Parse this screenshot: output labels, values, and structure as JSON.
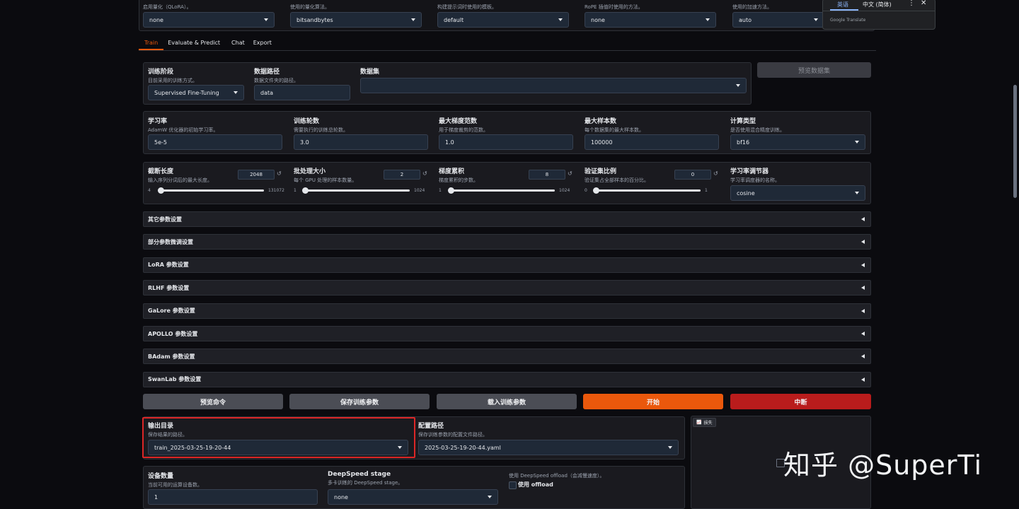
{
  "top_row": [
    {
      "label": "启用量化（QLoRA）。",
      "value": "none"
    },
    {
      "label": "使用的量化算法。",
      "value": "bitsandbytes"
    },
    {
      "label": "构建提示词时使用的模板。",
      "value": "default"
    },
    {
      "label": "RoPE 插值时使用的方法。",
      "value": "none"
    },
    {
      "label": "使用的加速方法。",
      "value": "auto"
    }
  ],
  "translate_popup": {
    "tab_active": "英语",
    "tab_other": "中文 (简体)",
    "brand": "Google Translate"
  },
  "tabs": [
    "Train",
    "Evaluate & Predict",
    "Chat",
    "Export"
  ],
  "row1": {
    "stage": {
      "label": "训练阶段",
      "sub": "目前采用的训练方式。",
      "value": "Supervised Fine-Tuning"
    },
    "path": {
      "label": "数据路径",
      "sub": "数据文件夹的路径。",
      "value": "data"
    },
    "dataset": {
      "label": "数据集",
      "value": ""
    },
    "preview_button": "预览数据集"
  },
  "row2": [
    {
      "label": "学习率",
      "sub": "AdamW 优化器的初始学习率。",
      "value": "5e-5"
    },
    {
      "label": "训练轮数",
      "sub": "需要执行的训练总轮数。",
      "value": "3.0"
    },
    {
      "label": "最大梯度范数",
      "sub": "用于梯度裁剪的范数。",
      "value": "1.0"
    },
    {
      "label": "最大样本数",
      "sub": "每个数据集的最大样本数。",
      "value": "100000"
    },
    {
      "label": "计算类型",
      "sub": "是否使用混合精度训练。",
      "value": "bf16"
    }
  ],
  "row3": [
    {
      "label": "截断长度",
      "sub": "输入序列分词后的最大长度。",
      "value": "2048",
      "min": "4",
      "max": "131072",
      "fraction": 0.015
    },
    {
      "label": "批处理大小",
      "sub": "每个 GPU 处理的样本数量。",
      "value": "2",
      "min": "1",
      "max": "1024",
      "fraction": 0.001
    },
    {
      "label": "梯度累积",
      "sub": "梯度累积的步数。",
      "value": "8",
      "min": "1",
      "max": "1024",
      "fraction": 0.007
    },
    {
      "label": "验证集比例",
      "sub": "验证集占全部样本的百分比。",
      "value": "0",
      "min": "0",
      "max": "1",
      "fraction": 0.0
    }
  ],
  "scheduler": {
    "label": "学习率调节器",
    "sub": "学习率调度器的名称。",
    "value": "cosine"
  },
  "accordions": [
    "其它参数设置",
    "部分参数微调设置",
    "LoRA 参数设置",
    "RLHF 参数设置",
    "GaLore 参数设置",
    "APOLLO 参数设置",
    "BAdam 参数设置",
    "SwanLab 参数设置"
  ],
  "actions": [
    "预览命令",
    "保存训练参数",
    "载入训练参数",
    "开始",
    "中断"
  ],
  "output": {
    "label": "输出目录",
    "sub": "保存结果的路径。",
    "value": "train_2025-03-25-19-20-44"
  },
  "config": {
    "label": "配置路径",
    "sub": "保存训练参数的配置文件路径。",
    "value": "2025-03-25-19-20-44.yaml"
  },
  "loss_label": "损失",
  "device": {
    "label": "设备数量",
    "sub": "当前可用的运算设备数。",
    "value": "1"
  },
  "deepspeed": {
    "label": "DeepSpeed stage",
    "sub": "多卡训练的 DeepSpeed stage。",
    "value": "none"
  },
  "offload": {
    "label": "使用 DeepSpeed offload（会减慢速度）。",
    "check_label": "使用 offload"
  },
  "watermark": "知乎 @SuperTi",
  "colors": {
    "accent": "#ea580c",
    "stop": "#b91c1c",
    "highlight": "#dc2626"
  }
}
